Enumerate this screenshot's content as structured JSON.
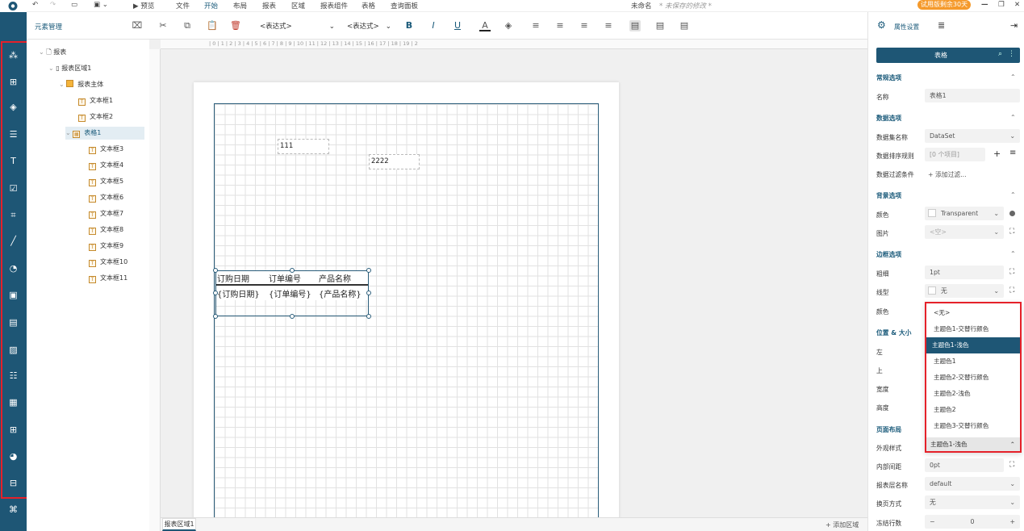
{
  "topbar": {
    "menus": [
      "预览",
      "文件",
      "开始",
      "布局",
      "报表",
      "区域",
      "报表组件",
      "表格",
      "查询面板"
    ],
    "active_menu": "开始",
    "doc_title": "未命名",
    "unsaved": "* 未保存的修改 *",
    "trial": "试用版剩余30天"
  },
  "toolbar": {
    "panel_label": "元素管理",
    "expr1": "<表达式>",
    "expr2": "<表达式>",
    "props_label": "属性设置"
  },
  "tree": {
    "root": "报表",
    "region": "报表区域1",
    "body": "报表主体",
    "items": [
      "文本框1",
      "文本框2",
      "表格1",
      "文本框3",
      "文本框4",
      "文本框5",
      "文本框6",
      "文本框7",
      "文本框8",
      "文本框9",
      "文本框10",
      "文本框11"
    ]
  },
  "ruler": "| 0 | 1 | 2 | 3 | 4 | 5 | 6 | 7 | 8 | 9 | 10 | 11 | 12 | 13 | 14 | 15 | 16 | 17 | 18 | 19 | 2",
  "canvas": {
    "textbox1": "111",
    "textbox2": "2222",
    "table_headers": [
      "订购日期",
      "订单编号",
      "产品名称"
    ],
    "table_row": [
      "{订购日期}",
      "{订单编号}",
      "{产品名称}"
    ],
    "bottom_tab": "报表区域1",
    "add_region": "+ 添加区域"
  },
  "panel": {
    "component": "表格",
    "sections": {
      "general": "常规选项",
      "data": "数据选项",
      "background": "背景选项",
      "border": "边框选项",
      "position": "位置 & 大小",
      "layout": "页面布局"
    },
    "labels": {
      "name": "名称",
      "dataset": "数据集名称",
      "sort": "数据排序规则",
      "filter": "数据过滤条件",
      "color": "颜色",
      "image": "图片",
      "width": "粗细",
      "style": "线型",
      "border_color": "颜色",
      "left": "左",
      "top": "上",
      "w": "宽度",
      "h": "高度",
      "appearance": "外观样式",
      "padding": "内部间距",
      "layer": "报表层名称",
      "paging": "换页方式",
      "freeze": "冻结行数"
    },
    "values": {
      "name": "表格1",
      "dataset": "DataSet",
      "sort": "[0 个项目]",
      "filter": "+ 添加过滤...",
      "color": "Transparent",
      "image": "<空>",
      "width": "1pt",
      "style": "无",
      "appearance": "主题色1-浅色",
      "padding": "0pt",
      "layer": "default",
      "paging": "无",
      "freeze": "0"
    },
    "dropdown_options": [
      "<无>",
      "主题色1-交替行颜色",
      "主题色1-浅色",
      "主题色1",
      "主题色2-交替行颜色",
      "主题色2-浅色",
      "主题色2",
      "主题色3-交替行颜色"
    ],
    "dropdown_selected": "主题色1-浅色"
  },
  "colors": {
    "accent": "#1e5675",
    "highlight": "#e5212a",
    "trial": "#f59a2c"
  }
}
